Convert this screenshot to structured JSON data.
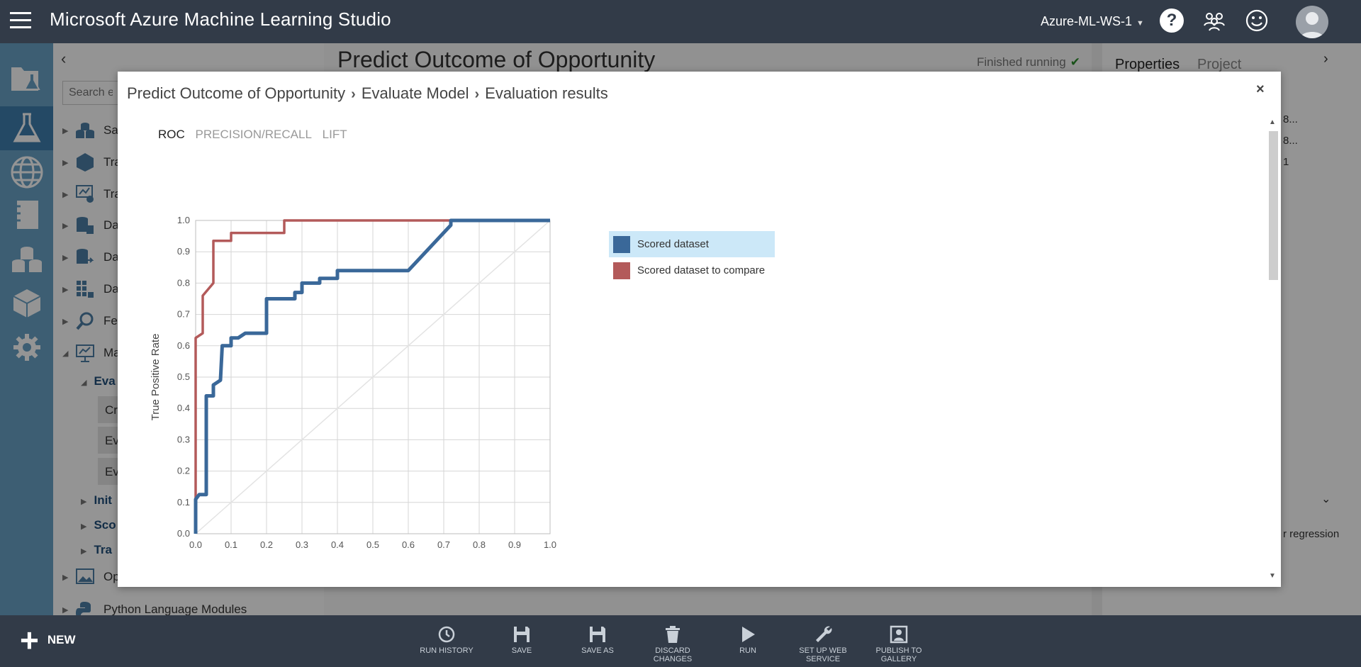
{
  "header": {
    "app_title": "Microsoft Azure Machine Learning Studio",
    "workspace": "Azure-ML-WS-1",
    "help_glyph": "?",
    "icons": [
      "hamburger-icon",
      "help-icon",
      "people-icon",
      "smile-icon",
      "avatar-icon"
    ]
  },
  "rail": {
    "items": [
      "projects-icon",
      "experiments-icon",
      "web-services-icon",
      "notebooks-icon",
      "datasets-icon",
      "trained-models-icon",
      "settings-icon"
    ],
    "active_index": 1
  },
  "palette": {
    "collapse_glyph": "‹",
    "search_placeholder": "Search exp",
    "rows": [
      {
        "label": "Sa",
        "icon": "saved-datasets-icon"
      },
      {
        "label": "Tra",
        "icon": "trained-models-icon"
      },
      {
        "label": "Tra",
        "icon": "transforms-icon"
      },
      {
        "label": "Da",
        "icon": "data-format-icon"
      },
      {
        "label": "Da",
        "icon": "data-input-output-icon"
      },
      {
        "label": "Da",
        "icon": "data-transformation-icon"
      },
      {
        "label": "Fe",
        "icon": "feature-selection-icon"
      },
      {
        "label": "Ma",
        "icon": "machine-learning-icon"
      }
    ],
    "sub_eval": "Eva",
    "leaves": [
      "Cr",
      "Ev",
      "Ev"
    ],
    "subs": [
      "Init",
      "Sco",
      "Tra"
    ],
    "op_row": "Op",
    "python_row": "Python Language Modules"
  },
  "canvas": {
    "experiment_title": "Predict Outcome of Opportunity",
    "status": "Finished running",
    "status_check": "✔"
  },
  "properties": {
    "tabs": [
      "Properties",
      "Project"
    ],
    "expand_glyph": "›",
    "collapse_glyph": "⌄",
    "values": [
      "8...",
      "8...",
      "1"
    ],
    "regression_text": "r regression"
  },
  "modal": {
    "breadcrumb": [
      "Predict Outcome of Opportunity",
      "Evaluate Model",
      "Evaluation results"
    ],
    "separator": "›",
    "close": "×",
    "tabs": [
      "ROC",
      "PRECISION/RECALL",
      "LIFT"
    ],
    "active_tab": 0,
    "scroll_up": "▲",
    "scroll_down": "▼"
  },
  "chart_data": {
    "type": "line",
    "title": "",
    "xlabel": "",
    "ylabel": "True Positive Rate",
    "xlim": [
      0,
      1
    ],
    "ylim": [
      0,
      1
    ],
    "x_ticks": [
      "0.0",
      "0.1",
      "0.2",
      "0.3",
      "0.4",
      "0.5",
      "0.6",
      "0.7",
      "0.8",
      "0.9",
      "1.0"
    ],
    "y_ticks": [
      "0.0",
      "0.1",
      "0.2",
      "0.3",
      "0.4",
      "0.5",
      "0.6",
      "0.7",
      "0.8",
      "0.9",
      "1.0"
    ],
    "grid": true,
    "legend_position": "right",
    "series": [
      {
        "name": "Scored dataset",
        "color": "#3a6899",
        "x": [
          0.0,
          0.0,
          0.01,
          0.03,
          0.03,
          0.05,
          0.05,
          0.07,
          0.075,
          0.1,
          0.1,
          0.12,
          0.14,
          0.2,
          0.2,
          0.28,
          0.28,
          0.3,
          0.3,
          0.35,
          0.35,
          0.4,
          0.4,
          0.6,
          0.72,
          0.72,
          1.0
        ],
        "y": [
          0.0,
          0.11,
          0.125,
          0.125,
          0.44,
          0.44,
          0.475,
          0.49,
          0.6,
          0.6,
          0.625,
          0.625,
          0.64,
          0.64,
          0.75,
          0.75,
          0.77,
          0.77,
          0.8,
          0.8,
          0.815,
          0.815,
          0.84,
          0.84,
          0.985,
          1.0,
          1.0
        ]
      },
      {
        "name": "Scored dataset to compare",
        "color": "#b35a5a",
        "x": [
          0.0,
          0.0,
          0.02,
          0.02,
          0.05,
          0.05,
          0.1,
          0.1,
          0.25,
          0.25,
          1.0
        ],
        "y": [
          0.0,
          0.625,
          0.64,
          0.76,
          0.8,
          0.935,
          0.935,
          0.96,
          0.96,
          1.0,
          1.0
        ]
      }
    ],
    "diagonal": true,
    "selected_series": 0
  },
  "cmdbar": {
    "new_label": "NEW",
    "commands": [
      {
        "label": "RUN HISTORY",
        "icon": "clock-icon"
      },
      {
        "label": "SAVE",
        "icon": "save-icon"
      },
      {
        "label": "SAVE AS",
        "icon": "save-as-icon"
      },
      {
        "label": "DISCARD CHANGES",
        "icon": "trash-icon"
      },
      {
        "label": "RUN",
        "icon": "play-icon"
      },
      {
        "label": "SET UP WEB SERVICE",
        "icon": "wrench-icon"
      },
      {
        "label": "PUBLISH TO GALLERY",
        "icon": "publish-icon"
      }
    ]
  }
}
